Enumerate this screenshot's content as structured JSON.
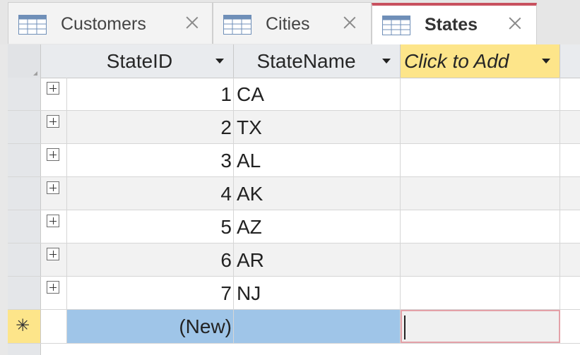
{
  "tabs": [
    {
      "label": "Customers",
      "active": false,
      "icon": "table-icon"
    },
    {
      "label": "Cities",
      "active": false,
      "icon": "table-icon"
    },
    {
      "label": "States",
      "active": true,
      "icon": "table-icon"
    }
  ],
  "columns": {
    "state_id": "StateID",
    "state_name": "StateName",
    "click_to_add": "Click to Add"
  },
  "rows": [
    {
      "id": "1",
      "name": "CA"
    },
    {
      "id": "2",
      "name": "TX"
    },
    {
      "id": "3",
      "name": "AL"
    },
    {
      "id": "4",
      "name": "AK"
    },
    {
      "id": "5",
      "name": "AZ"
    },
    {
      "id": "6",
      "name": "AR"
    },
    {
      "id": "7",
      "name": "NJ"
    }
  ],
  "new_row": {
    "id_placeholder": "(New)",
    "marker": "✳"
  },
  "colors": {
    "active_tab_accent": "#c8515f",
    "click_to_add_bg": "#fde58a",
    "new_row_selection": "#9fc5e8"
  }
}
